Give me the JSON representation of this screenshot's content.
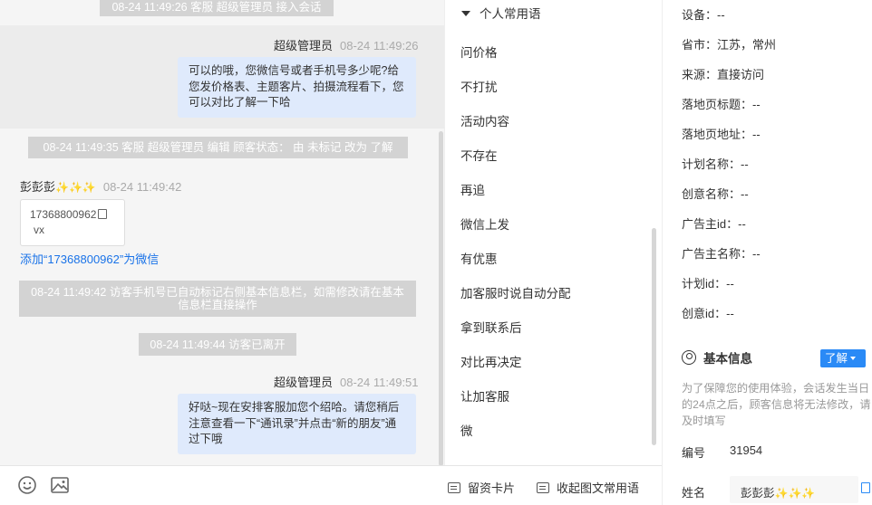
{
  "chat": {
    "sys1": "08-24 11:49:26 客服 超级管理员 接入会话",
    "msg1": {
      "sender": "超级管理员",
      "time": "08-24 11:49:26",
      "text": "可以的哦，您微信号或者手机号多少呢?给您发价格表、主题客片、拍摄流程看下，您可以对比了解一下哈"
    },
    "sys2": "08-24 11:49:35 客服 超级管理员 编辑 顾客状态： 由 未标记 改为 了解",
    "msg2": {
      "sender": "彭彭彭",
      "emoji": "✨✨✨",
      "time": "08-24 11:49:42",
      "card_number": "17368800962",
      "card_sub": "vx",
      "add_link": "添加“17368800962”为微信"
    },
    "sys3": "08-24 11:49:42 访客手机号已自动标记右侧基本信息栏，如需修改请在基本信息栏直接操作",
    "sys4": "08-24 11:49:44 访客已离开",
    "msg3": {
      "sender": "超级管理员",
      "time": "08-24 11:49:51",
      "text": "好哒~现在安排客服加您个绍哈。请您稍后注意查看一下“通讯录”并点击“新的朋友”通过下哦"
    },
    "toolbar": {
      "emoji_icon": "smile-icon",
      "image_icon": "image-icon"
    }
  },
  "phrases": {
    "header": "个人常用语",
    "items": [
      "问价格",
      "不打扰",
      "活动内容",
      "不存在",
      "再追",
      "微信上发",
      "有优惠",
      "加客服时说自动分配",
      "拿到联系后",
      "对比再决定",
      "让加客服",
      "微"
    ],
    "footer": {
      "card_btn": "留资卡片",
      "collapse_btn": "收起图文常用语"
    }
  },
  "info": {
    "rows": [
      "设备：--",
      "省市：江苏，常州",
      "来源：直接访问",
      "落地页标题：--",
      "落地页地址：--",
      "计划名称：--",
      "创意名称：--",
      "广告主id：--",
      "广告主名称：--",
      "计划id：--",
      "创意id：--"
    ],
    "section_title": "基本信息",
    "status_btn": "了解",
    "note": "为了保障您的使用体验，会话发生当日的24点之后，顾客信息将无法修改，请及时填写",
    "id_label": "编号",
    "id_value": "31954",
    "name_label": "姓名",
    "name_value": "彭彭彭",
    "name_emoji": "✨✨✨"
  },
  "colors": {
    "accent": "#2a8af6",
    "bubble": "#dfeafc",
    "system_bg": "#d3d3d3"
  }
}
